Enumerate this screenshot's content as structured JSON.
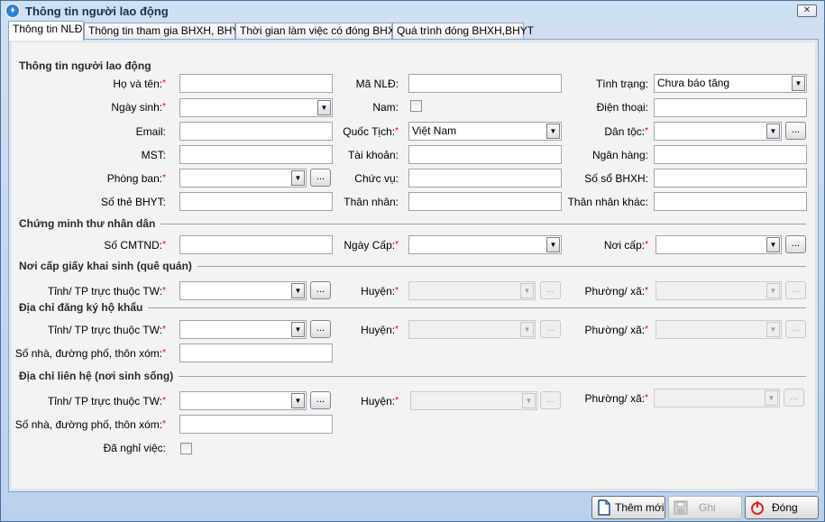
{
  "window": {
    "title": "Thông tin người lao động",
    "close_glyph": "☒",
    "icon": "app-icon"
  },
  "tabs": [
    "Thông tin NLĐ",
    "Thông tin tham gia BHXH, BHYT",
    "Thời gian làm việc có đóng BHXH",
    "Quá trình đóng BHXH,BHYT"
  ],
  "sections": {
    "worker": "Thông tin người lao động",
    "id_card": "Chứng minh thư nhân dân",
    "birth": "Nơi cấp giấy khai sinh (quê quán)",
    "resident": "Địa chỉ đăng ký hộ khẩu",
    "contact": "Địa chỉ liên hệ (nơi sinh sống)"
  },
  "labels": {
    "ho_ten": "Họ và tên:",
    "ma_nld": "Mã NLĐ:",
    "tinh_trang": "Tình trạng:",
    "ngay_sinh": "Ngày sinh:",
    "nam": "Nam:",
    "dien_thoai": "Điện thoại:",
    "email": "Email:",
    "quoc_tich": "Quốc Tịch:",
    "dan_toc": "Dân tộc:",
    "mst": "MST:",
    "tai_khoan": "Tài khoản:",
    "ngan_hang": "Ngân hàng:",
    "phong_ban": "Phòng ban:",
    "chuc_vu": "Chức vụ:",
    "so_bhxh": "Số sổ BHXH:",
    "so_bhyt": "Số thẻ BHYT:",
    "than_nhan": "Thân nhân:",
    "than_nhan_khac": "Thân nhân khác:",
    "so_cmtnd": "Số CMTND:",
    "ngay_cap": "Ngày Cấp:",
    "noi_cap": "Nơi cấp:",
    "tinh": "Tỉnh/ TP trực thuộc TW:",
    "huyen": "Huyện:",
    "phuong": "Phường/ xã:",
    "so_nha": "Số nhà, đường phố, thôn xóm:",
    "da_nghi": "Đã nghỉ việc:"
  },
  "values": {
    "tinh_trang": "Chưa báo tăng",
    "quoc_tich": "Việt Nam"
  },
  "required_mark": "*",
  "ellipsis": "...",
  "dropdown_glyph": "▼",
  "buttons": {
    "them_moi": "Thêm mới",
    "ghi": "Ghi",
    "dong": "Đóng"
  },
  "colors": {
    "accent": "#3d8fd9",
    "required": "#e00000",
    "close_red": "#d9261c"
  }
}
